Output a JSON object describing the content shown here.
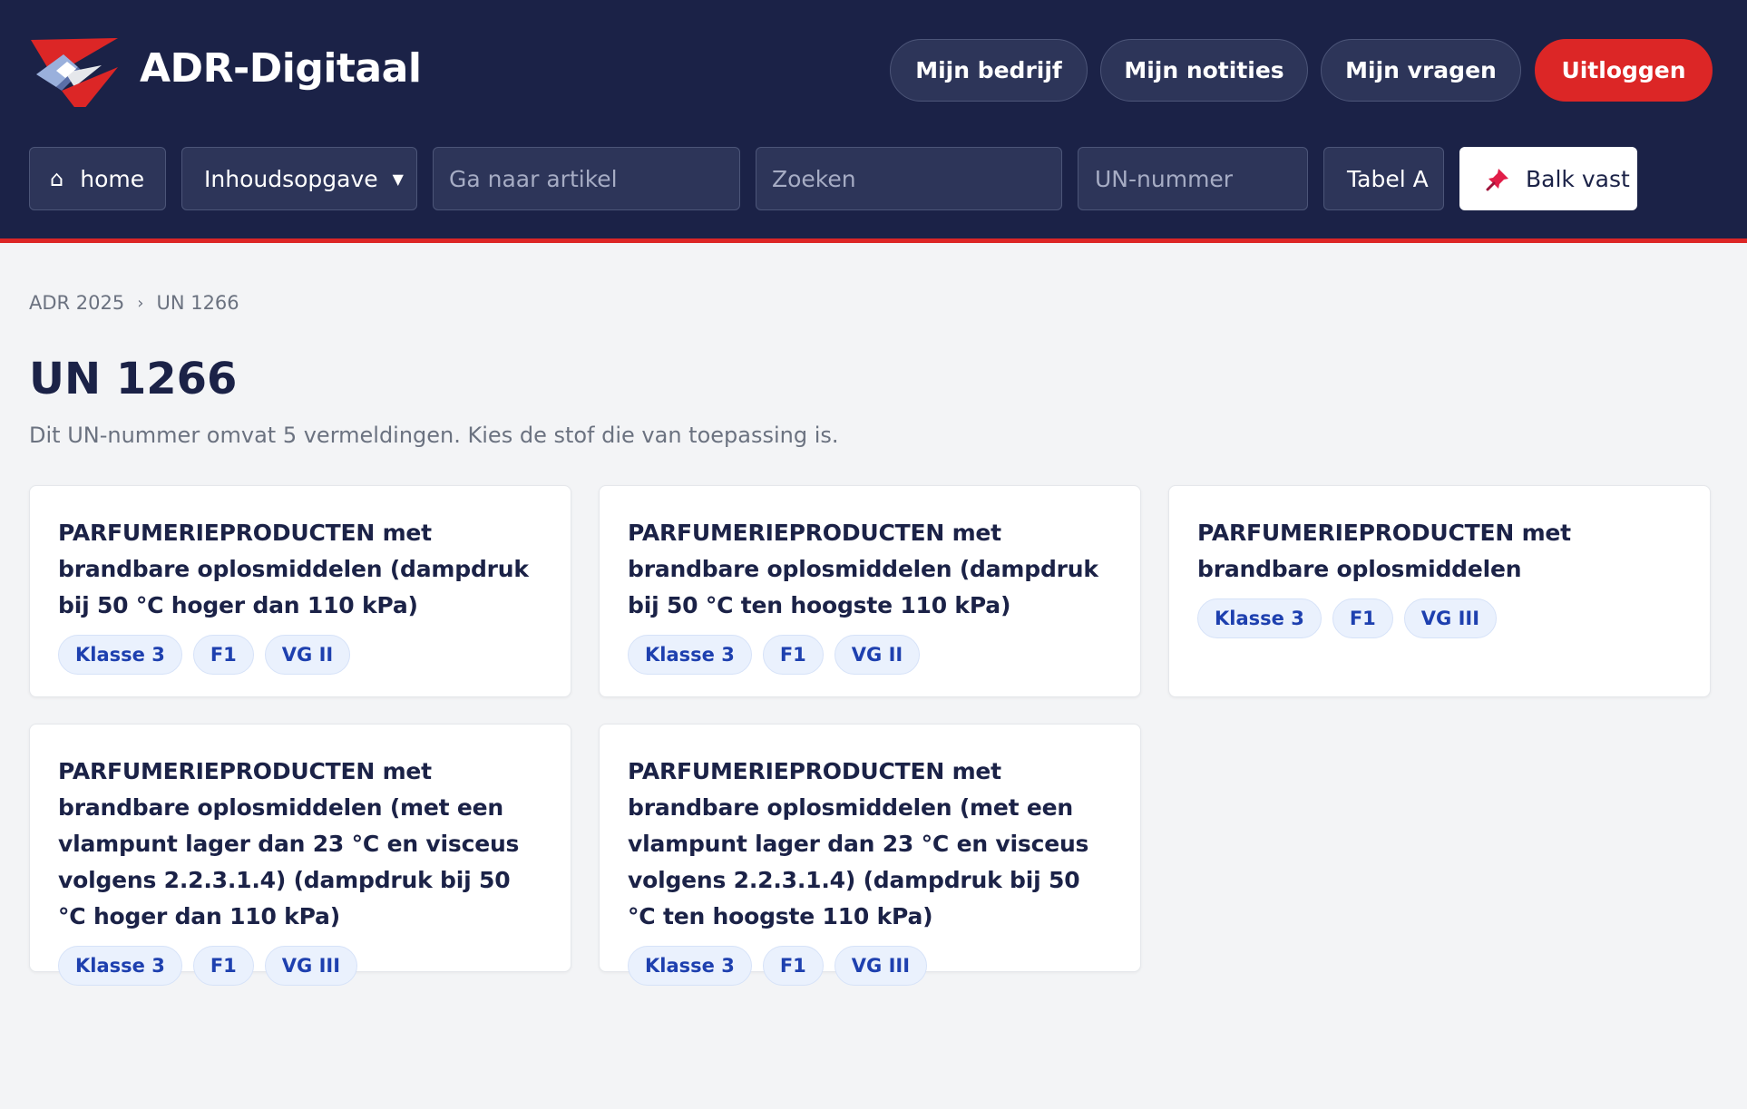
{
  "brand": {
    "name": "ADR-Digitaal"
  },
  "top_nav": {
    "my_company": "Mijn bedrijf",
    "my_notes": "Mijn notities",
    "my_questions": "Mijn vragen",
    "logout": "Uitloggen"
  },
  "toolbar": {
    "home": "home",
    "toc": "Inhoudsopgave",
    "article_placeholder": "Ga naar artikel",
    "search_placeholder": "Zoeken",
    "un_placeholder": "UN-nummer",
    "table_a": "Tabel A",
    "pin_bar": "Balk vast"
  },
  "breadcrumb": {
    "root": "ADR 2025",
    "current": "UN 1266"
  },
  "page": {
    "title": "UN 1266",
    "subtitle": "Dit UN-nummer omvat 5 vermeldingen. Kies de stof die van toepassing is."
  },
  "entries": [
    {
      "title": "PARFUMERIEPRODUCTEN met brandbare oplosmiddelen (dampdruk bij 50 °C hoger dan 110 kPa)",
      "tags": [
        "Klasse 3",
        "F1",
        "VG II"
      ]
    },
    {
      "title": "PARFUMERIEPRODUCTEN met brandbare oplosmiddelen (dampdruk bij 50 °C ten hoogste 110 kPa)",
      "tags": [
        "Klasse 3",
        "F1",
        "VG II"
      ]
    },
    {
      "title": "PARFUMERIEPRODUCTEN met brandbare oplosmiddelen",
      "tags": [
        "Klasse 3",
        "F1",
        "VG III"
      ]
    },
    {
      "title": "PARFUMERIEPRODUCTEN met brandbare oplosmiddelen (met een vlampunt lager dan 23 °C en visceus volgens 2.2.3.1.4) (dampdruk bij 50 °C hoger dan 110 kPa)",
      "tags": [
        "Klasse 3",
        "F1",
        "VG III"
      ]
    },
    {
      "title": "PARFUMERIEPRODUCTEN met brandbare oplosmiddelen (met een vlampunt lager dan 23 °C en visceus volgens 2.2.3.1.4) (dampdruk bij 50 °C ten hoogste 110 kPa)",
      "tags": [
        "Klasse 3",
        "F1",
        "VG III"
      ]
    }
  ],
  "colors": {
    "header_bg": "#1b2247",
    "accent_red": "#dc2626",
    "chip_text": "#1e40af",
    "page_bg": "#f3f4f6"
  },
  "icons": {
    "logo": "diamond-arrow-logo",
    "home": "home-icon",
    "dropdown": "caret-down-icon",
    "pin": "pushpin-icon",
    "breadcrumb_separator": "chevron-right-icon"
  }
}
